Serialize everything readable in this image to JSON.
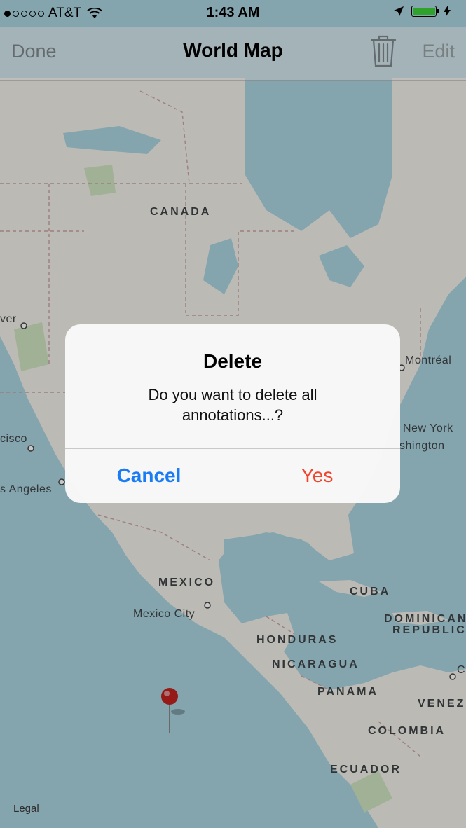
{
  "status_bar": {
    "carrier": "AT&T",
    "time": "1:43 AM",
    "signal_bars_filled": 1,
    "signal_bars_total": 5,
    "battery_color": "#3cd036"
  },
  "nav_bar": {
    "done_label": "Done",
    "title": "World Map",
    "edit_label": "Edit",
    "trash_icon": "trash-icon"
  },
  "map": {
    "countries": {
      "canada": "CANADA",
      "mexico": "MEXICO",
      "cuba": "CUBA",
      "dominican_1": "DOMINICAN",
      "dominican_2": "REPUBLIC",
      "honduras": "HONDURAS",
      "nicaragua": "NICARAGUA",
      "panama": "PANAMA",
      "venezuela": "VENEZ",
      "colombia": "COLOMBIA",
      "ecuador": "ECUADOR"
    },
    "cities": {
      "vancouver": "ver",
      "montreal": "Montréal",
      "new_york": "New York",
      "washington": "shington",
      "san_francisco": "cisco",
      "los_angeles": "s Angeles",
      "mexico_city": "Mexico City",
      "caracas": "C"
    },
    "legal": "Legal",
    "pin_color": "#c0231f"
  },
  "alert": {
    "title": "Delete",
    "message": "Do you want to delete all annotations...?",
    "cancel_label": "Cancel",
    "yes_label": "Yes",
    "cancel_color": "#1a7cf5",
    "yes_color": "#f0442e"
  }
}
